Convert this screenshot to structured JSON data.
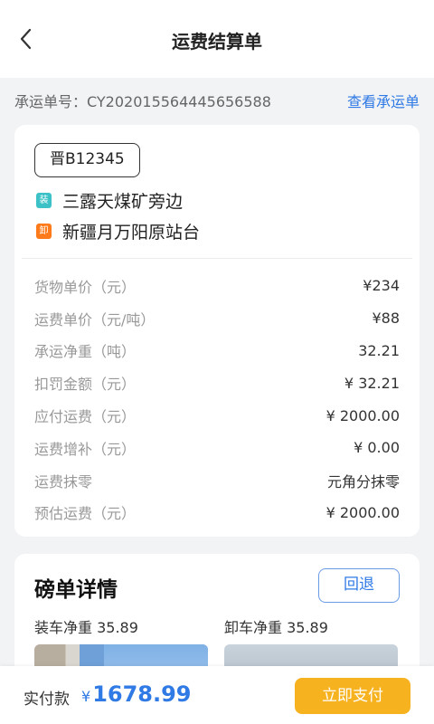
{
  "header": {
    "title": "运费结算单",
    "back_icon": "chevron-left-icon"
  },
  "order": {
    "label": "承运单号：CY202015564445656588",
    "link": "查看承运单"
  },
  "vehicle": {
    "plate": "晋B12345"
  },
  "route": {
    "load_tag": "装",
    "load_place": "三露天煤矿旁边",
    "unload_tag": "卸",
    "unload_place": "新疆月万阳原站台"
  },
  "fees": [
    {
      "label": "货物单价（元）",
      "value": "¥234"
    },
    {
      "label": "运费单价（元/吨）",
      "value": "¥88"
    },
    {
      "label": "承运净重（吨）",
      "value": "32.21"
    },
    {
      "label": "扣罚金额（元）",
      "value": "¥ 32.21"
    },
    {
      "label": "应付运费（元）",
      "value": "¥ 2000.00"
    },
    {
      "label": "运费增补（元）",
      "value": "¥ 0.00"
    },
    {
      "label": "运费抹零",
      "value": "元角分抹零"
    },
    {
      "label": "预估运费（元）",
      "value": "¥ 2000.00"
    }
  ],
  "weigh": {
    "title": "磅单详情",
    "back_button": "回退",
    "load_net": "装车净重  35.89",
    "unload_net": "卸车净重  35.89"
  },
  "footer": {
    "pay_label": "实付款",
    "currency": "¥",
    "amount": "1678.99",
    "pay_button": "立即支付"
  },
  "colors": {
    "accent": "#2f7ae5",
    "pay_button": "#f7b21f",
    "load_tag": "#3cc2c6",
    "unload_tag": "#ff7a1a"
  }
}
